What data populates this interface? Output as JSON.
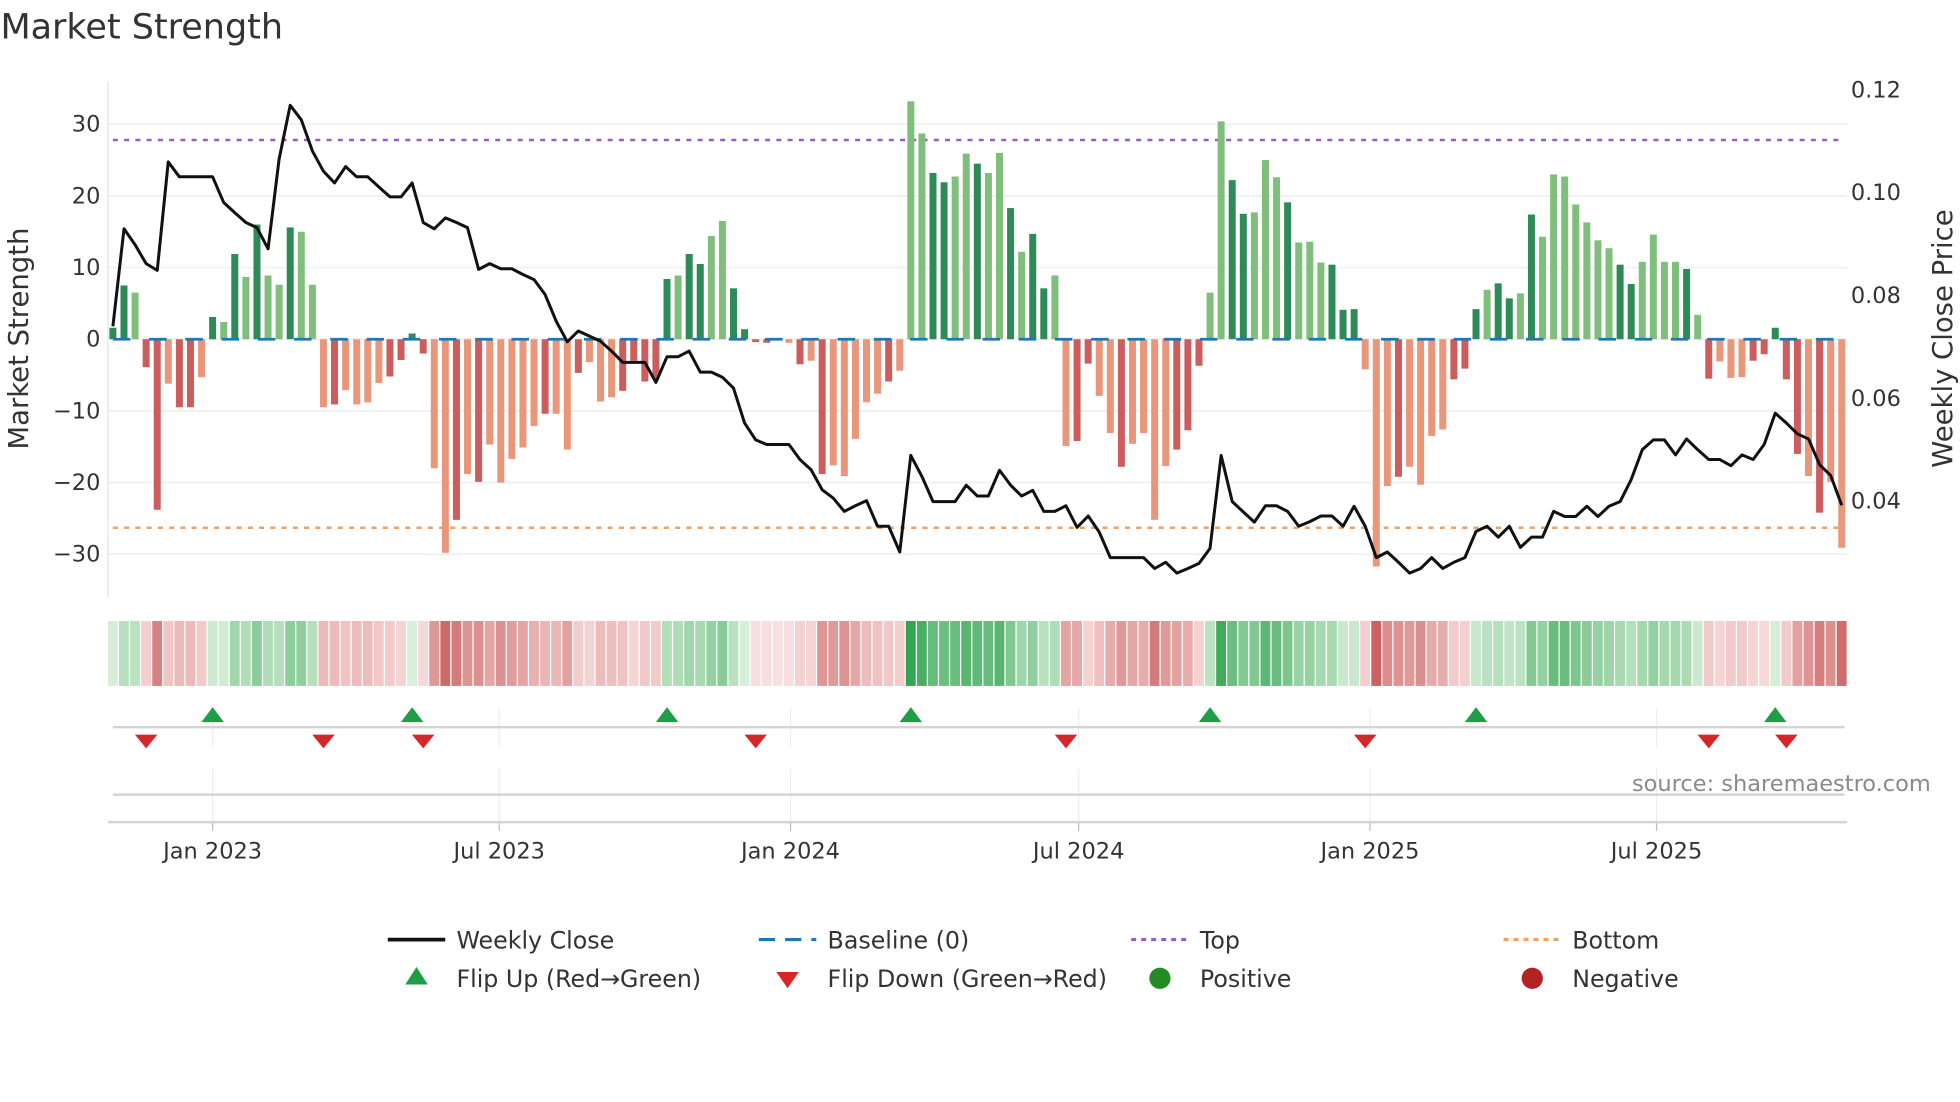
{
  "title": "Market Strength",
  "source": "source: sharemaestro.com",
  "chart_data": {
    "type": "bar",
    "title": "Market Strength",
    "ylabel": "Market Strength",
    "y2label": "Weekly Close Price",
    "ylim": [
      -36,
      36
    ],
    "y2lim": [
      0.0213,
      0.1217
    ],
    "start_date": "2022-10-30",
    "interval": "weekly",
    "grid": true,
    "legend_position": "bottom",
    "top_level": 27.8,
    "bottom_level": -26.3,
    "baseline": 0,
    "colors": {
      "pos_dark": "#2e8b57",
      "pos_light": "#7fbf7b",
      "neg_dark": "#cd5c5c",
      "neg_light": "#e9967a",
      "weekly_close": "#111111",
      "baseline": "#1f77b4",
      "top": "#9b59d0",
      "bottom": "#f0a060",
      "flip_up": "#1f9e48",
      "flip_down": "#d62728",
      "positive": "#228b22",
      "negative": "#b22222"
    },
    "bar_shades": "ddlddlddldldldlldllldllllddddlldldllllldlldllldddddlddlldddddldldllllldlllddlldlldlddllddlldlllldddllddllldllldddllldlllldddlddldlllllllddlllldldllldddddld",
    "strength": [
      1.6,
      7.5,
      6.5,
      -3.9,
      -23.8,
      -6.2,
      -9.5,
      -9.5,
      -5.3,
      3.1,
      2.4,
      11.9,
      8.7,
      16,
      8.9,
      7.6,
      15.6,
      15,
      7.6,
      -9.5,
      -9.1,
      -7.1,
      -9.1,
      -8.8,
      -6.1,
      -5.2,
      -2.9,
      0.8,
      -2,
      -18,
      -29.8,
      -25.2,
      -18.8,
      -19.9,
      -14.7,
      -20,
      -16.7,
      -15.1,
      -12.1,
      -10.4,
      -10.4,
      -15.4,
      -4.7,
      -3.2,
      -8.7,
      -8.1,
      -7.2,
      -3,
      -5.9,
      -5.6,
      8.4,
      8.9,
      11.9,
      10.5,
      14.4,
      16.5,
      7.1,
      1.4,
      -0.4,
      -0.5,
      0,
      -0.5,
      -3.5,
      -3,
      -18.8,
      -17.6,
      -19.1,
      -13.9,
      -8.8,
      -7.6,
      -5.9,
      -4.4,
      33.2,
      28.7,
      23.2,
      21.9,
      22.7,
      25.9,
      24.5,
      23.2,
      26,
      18.3,
      12.2,
      14.7,
      7.1,
      8.9,
      -14.9,
      -14.2,
      -3.4,
      -7.9,
      -13.1,
      -17.8,
      -14.6,
      -13.1,
      -25.2,
      -17.7,
      -15.4,
      -12.7,
      -3.7,
      6.5,
      30.4,
      22.2,
      17.5,
      17.7,
      25,
      22.6,
      19.1,
      13.5,
      13.6,
      10.7,
      10.4,
      4.1,
      4.2,
      -4.2,
      -31.7,
      -20.5,
      -19.2,
      -17.8,
      -20.3,
      -13.5,
      -12.6,
      -5.6,
      -4.1,
      4.2,
      6.9,
      7.8,
      5.7,
      6.4,
      17.4,
      14.3,
      23,
      22.7,
      18.8,
      16.3,
      13.8,
      12.7,
      10.4,
      7.7,
      10.8,
      14.6,
      10.8,
      10.8,
      9.8,
      3.4,
      -5.5,
      -3.1,
      -5.4,
      -5.3,
      -3,
      -2.1,
      1.6,
      -5.6,
      -16,
      -19.1,
      -24.2,
      -19.9,
      -29.1
    ],
    "weekly_close": [
      0.074,
      0.093,
      0.0899,
      0.0862,
      0.0849,
      0.106,
      0.1031,
      0.1031,
      0.1031,
      0.1031,
      0.0981,
      0.0961,
      0.0942,
      0.0932,
      0.0891,
      0.1065,
      0.117,
      0.1142,
      0.1081,
      0.1042,
      0.1019,
      0.1051,
      0.1031,
      0.1031,
      0.1011,
      0.0992,
      0.0992,
      0.1019,
      0.0942,
      0.093,
      0.0951,
      0.0942,
      0.0932,
      0.0851,
      0.0862,
      0.0852,
      0.0852,
      0.0841,
      0.0831,
      0.0802,
      0.075,
      0.071,
      0.0731,
      0.0721,
      0.0711,
      0.0692,
      0.067,
      0.067,
      0.067,
      0.0631,
      0.0681,
      0.0681,
      0.0692,
      0.0651,
      0.0651,
      0.0641,
      0.062,
      0.0552,
      0.0519,
      0.051,
      0.051,
      0.051,
      0.0481,
      0.0461,
      0.0422,
      0.0406,
      0.038,
      0.0391,
      0.0401,
      0.0351,
      0.0351,
      0.0301,
      0.0489,
      0.0448,
      0.0399,
      0.0399,
      0.0399,
      0.0431,
      0.041,
      0.041,
      0.046,
      0.0431,
      0.041,
      0.0421,
      0.038,
      0.038,
      0.0391,
      0.0349,
      0.0371,
      0.034,
      0.029,
      0.029,
      0.029,
      0.029,
      0.0269,
      0.0281,
      0.026,
      0.0269,
      0.0279,
      0.0308,
      0.0489,
      0.0399,
      0.0379,
      0.0359,
      0.0391,
      0.0391,
      0.038,
      0.0351,
      0.036,
      0.0371,
      0.0371,
      0.0351,
      0.039,
      0.0351,
      0.029,
      0.0301,
      0.0281,
      0.026,
      0.0269,
      0.029,
      0.0269,
      0.0281,
      0.029,
      0.0341,
      0.0351,
      0.033,
      0.0351,
      0.031,
      0.033,
      0.033,
      0.038,
      0.037,
      0.037,
      0.039,
      0.037,
      0.039,
      0.0399,
      0.0442,
      0.05,
      0.0519,
      0.0519,
      0.049,
      0.0521,
      0.05,
      0.0481,
      0.0481,
      0.0469,
      0.049,
      0.0481,
      0.051,
      0.0571,
      0.0552,
      0.0531,
      0.0521,
      0.0471,
      0.045,
      0.0392
    ],
    "y_ticks": [
      {
        "v": 30,
        "label": "30"
      },
      {
        "v": 20,
        "label": "20"
      },
      {
        "v": 10,
        "label": "10"
      },
      {
        "v": 0,
        "label": "0"
      },
      {
        "v": -10,
        "label": "−10"
      },
      {
        "v": -20,
        "label": "−20"
      },
      {
        "v": -30,
        "label": "−30"
      }
    ],
    "y2_ticks": [
      {
        "v": 0.12,
        "label": "0.12"
      },
      {
        "v": 0.1,
        "label": "0.10"
      },
      {
        "v": 0.08,
        "label": "0.08"
      },
      {
        "v": 0.06,
        "label": "0.06"
      },
      {
        "v": 0.04,
        "label": "0.04"
      }
    ],
    "x_ticks": [
      {
        "date": "2023-01-01",
        "label": "Jan 2023"
      },
      {
        "date": "2023-07-01",
        "label": "Jul 2023"
      },
      {
        "date": "2024-01-01",
        "label": "Jan 2024"
      },
      {
        "date": "2024-07-01",
        "label": "Jul 2024"
      },
      {
        "date": "2025-01-01",
        "label": "Jan 2025"
      },
      {
        "date": "2025-07-01",
        "label": "Jul 2025"
      }
    ],
    "legend": [
      {
        "key": "weekly_close",
        "label": "Weekly Close"
      },
      {
        "key": "baseline",
        "label": "Baseline (0)"
      },
      {
        "key": "top",
        "label": "Top"
      },
      {
        "key": "bottom",
        "label": "Bottom"
      },
      {
        "key": "flip_up",
        "label": "Flip Up (Red→Green)"
      },
      {
        "key": "flip_down",
        "label": "Flip Down (Green→Red)"
      },
      {
        "key": "positive",
        "label": "Positive"
      },
      {
        "key": "negative",
        "label": "Negative"
      }
    ]
  }
}
